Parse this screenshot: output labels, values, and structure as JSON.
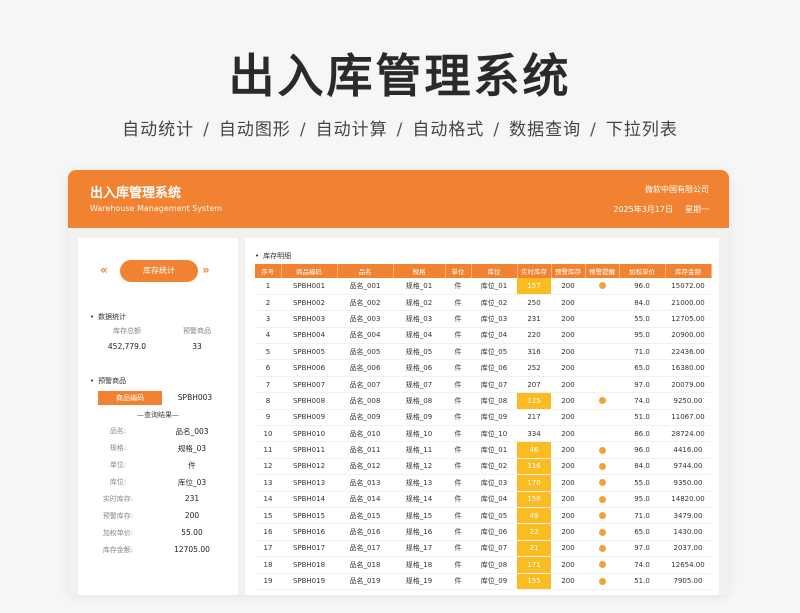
{
  "hero": {
    "title": "出入库管理系统",
    "features": [
      "自动统计",
      "自动图形",
      "自动计算",
      "自动格式",
      "数据查询",
      "下拉列表"
    ]
  },
  "header": {
    "title": "出入库管理系统",
    "subtitle": "Warehouse Management System",
    "company": "微软中国有限公司",
    "date": "2025年3月17日",
    "weekday": "星期一"
  },
  "colors": {
    "accent": "#f08232",
    "highlight": "#fbbc21",
    "warning_dot": "#f0a13a"
  },
  "left": {
    "stat_button": "库存统计",
    "data_section": "数据统计",
    "total_label": "库存总额",
    "warn_label": "预警商品",
    "total_value": "452,779.0",
    "warn_value": "33",
    "warn_section": "预警商品",
    "code_label": "商品编码",
    "code_value": "SPBH003",
    "query_title": "—查询结果—",
    "details": [
      {
        "k": "品名:",
        "v": "品名_003"
      },
      {
        "k": "规格:",
        "v": "规格_03"
      },
      {
        "k": "单位:",
        "v": "件"
      },
      {
        "k": "库位:",
        "v": "库位_03"
      },
      {
        "k": "实时库存:",
        "v": "231"
      },
      {
        "k": "预警库存:",
        "v": "200"
      },
      {
        "k": "加权单价:",
        "v": "55.00"
      },
      {
        "k": "库存金额:",
        "v": "12705.00"
      }
    ]
  },
  "table": {
    "title": "库存明细",
    "columns": [
      "序号",
      "商品编码",
      "品名",
      "规格",
      "单位",
      "库位",
      "实时库存",
      "预警库存",
      "预警提醒",
      "加权单价",
      "库存金额"
    ],
    "rows": [
      {
        "no": "1",
        "code": "SPBH001",
        "name": "品名_001",
        "spec": "规格_01",
        "unit": "件",
        "loc": "库位_01",
        "stock": "157",
        "warn": "200",
        "alert": true,
        "price": "96.0",
        "amount": "15072.00"
      },
      {
        "no": "2",
        "code": "SPBH002",
        "name": "品名_002",
        "spec": "规格_02",
        "unit": "件",
        "loc": "库位_02",
        "stock": "250",
        "warn": "200",
        "alert": false,
        "price": "84.0",
        "amount": "21000.00"
      },
      {
        "no": "3",
        "code": "SPBH003",
        "name": "品名_003",
        "spec": "规格_03",
        "unit": "件",
        "loc": "库位_03",
        "stock": "231",
        "warn": "200",
        "alert": false,
        "price": "55.0",
        "amount": "12705.00"
      },
      {
        "no": "4",
        "code": "SPBH004",
        "name": "品名_004",
        "spec": "规格_04",
        "unit": "件",
        "loc": "库位_04",
        "stock": "220",
        "warn": "200",
        "alert": false,
        "price": "95.0",
        "amount": "20900.00"
      },
      {
        "no": "5",
        "code": "SPBH005",
        "name": "品名_005",
        "spec": "规格_05",
        "unit": "件",
        "loc": "库位_05",
        "stock": "316",
        "warn": "200",
        "alert": false,
        "price": "71.0",
        "amount": "22436.00"
      },
      {
        "no": "6",
        "code": "SPBH006",
        "name": "品名_006",
        "spec": "规格_06",
        "unit": "件",
        "loc": "库位_06",
        "stock": "252",
        "warn": "200",
        "alert": false,
        "price": "65.0",
        "amount": "16380.00"
      },
      {
        "no": "7",
        "code": "SPBH007",
        "name": "品名_007",
        "spec": "规格_07",
        "unit": "件",
        "loc": "库位_07",
        "stock": "207",
        "warn": "200",
        "alert": false,
        "price": "97.0",
        "amount": "20079.00"
      },
      {
        "no": "8",
        "code": "SPBH008",
        "name": "品名_008",
        "spec": "规格_08",
        "unit": "件",
        "loc": "库位_08",
        "stock": "125",
        "warn": "200",
        "alert": true,
        "price": "74.0",
        "amount": "9250.00"
      },
      {
        "no": "9",
        "code": "SPBH009",
        "name": "品名_009",
        "spec": "规格_09",
        "unit": "件",
        "loc": "库位_09",
        "stock": "217",
        "warn": "200",
        "alert": false,
        "price": "51.0",
        "amount": "11067.00"
      },
      {
        "no": "10",
        "code": "SPBH010",
        "name": "品名_010",
        "spec": "规格_10",
        "unit": "件",
        "loc": "库位_10",
        "stock": "334",
        "warn": "200",
        "alert": false,
        "price": "86.0",
        "amount": "28724.00"
      },
      {
        "no": "11",
        "code": "SPBH011",
        "name": "品名_011",
        "spec": "规格_11",
        "unit": "件",
        "loc": "库位_01",
        "stock": "46",
        "warn": "200",
        "alert": true,
        "price": "96.0",
        "amount": "4416.00"
      },
      {
        "no": "12",
        "code": "SPBH012",
        "name": "品名_012",
        "spec": "规格_12",
        "unit": "件",
        "loc": "库位_02",
        "stock": "116",
        "warn": "200",
        "alert": true,
        "price": "84.0",
        "amount": "9744.00"
      },
      {
        "no": "13",
        "code": "SPBH013",
        "name": "品名_013",
        "spec": "规格_13",
        "unit": "件",
        "loc": "库位_03",
        "stock": "170",
        "warn": "200",
        "alert": true,
        "price": "55.0",
        "amount": "9350.00"
      },
      {
        "no": "14",
        "code": "SPBH014",
        "name": "品名_014",
        "spec": "规格_14",
        "unit": "件",
        "loc": "库位_04",
        "stock": "156",
        "warn": "200",
        "alert": true,
        "price": "95.0",
        "amount": "14820.00"
      },
      {
        "no": "15",
        "code": "SPBH015",
        "name": "品名_015",
        "spec": "规格_15",
        "unit": "件",
        "loc": "库位_05",
        "stock": "49",
        "warn": "200",
        "alert": true,
        "price": "71.0",
        "amount": "3479.00"
      },
      {
        "no": "16",
        "code": "SPBH016",
        "name": "品名_016",
        "spec": "规格_16",
        "unit": "件",
        "loc": "库位_06",
        "stock": "22",
        "warn": "200",
        "alert": true,
        "price": "65.0",
        "amount": "1430.00"
      },
      {
        "no": "17",
        "code": "SPBH017",
        "name": "品名_017",
        "spec": "规格_17",
        "unit": "件",
        "loc": "库位_07",
        "stock": "21",
        "warn": "200",
        "alert": true,
        "price": "97.0",
        "amount": "2037.00"
      },
      {
        "no": "18",
        "code": "SPBH018",
        "name": "品名_018",
        "spec": "规格_18",
        "unit": "件",
        "loc": "库位_08",
        "stock": "171",
        "warn": "200",
        "alert": true,
        "price": "74.0",
        "amount": "12654.00"
      },
      {
        "no": "19",
        "code": "SPBH019",
        "name": "品名_019",
        "spec": "规格_19",
        "unit": "件",
        "loc": "库位_09",
        "stock": "155",
        "warn": "200",
        "alert": true,
        "price": "51.0",
        "amount": "7905.00"
      }
    ]
  }
}
